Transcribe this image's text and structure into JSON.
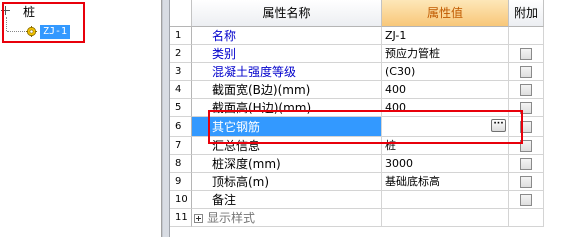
{
  "tree": {
    "root_label": "桩",
    "child_label": "ZJ-1"
  },
  "grid": {
    "headers": {
      "number": "",
      "name": "属性名称",
      "value": "属性值",
      "extra": "附加"
    },
    "rows": [
      {
        "num": "1",
        "name": "名称",
        "value": "ZJ-1",
        "name_color": "blue",
        "checkbox": false
      },
      {
        "num": "2",
        "name": "类别",
        "value": "预应力管桩",
        "name_color": "blue",
        "checkbox": true
      },
      {
        "num": "3",
        "name": "混凝土强度等级",
        "value": "(C30)",
        "name_color": "blue",
        "checkbox": true
      },
      {
        "num": "4",
        "name": "截面宽(B边)(mm)",
        "value": "400",
        "name_color": "black",
        "checkbox": true
      },
      {
        "num": "5",
        "name": "截面高(H边)(mm)",
        "value": "400",
        "name_color": "black",
        "checkbox": true
      },
      {
        "num": "6",
        "name": "其它钢筋",
        "value": "",
        "name_color": "black",
        "checkbox": true,
        "selected": true
      },
      {
        "num": "7",
        "name": "汇总信息",
        "value": "桩",
        "name_color": "black",
        "checkbox": true
      },
      {
        "num": "8",
        "name": "桩深度(mm)",
        "value": "3000",
        "name_color": "black",
        "checkbox": true
      },
      {
        "num": "9",
        "name": "顶标高(m)",
        "value": "基础底标高",
        "name_color": "black",
        "checkbox": true
      },
      {
        "num": "10",
        "name": "备注",
        "value": "",
        "name_color": "black",
        "checkbox": true
      },
      {
        "num": "11",
        "name": "显示样式",
        "value": "",
        "name_color": "gray",
        "checkbox": false,
        "expandable": true
      }
    ],
    "ellipsis_label": "···"
  },
  "colors": {
    "selection": "#3399ff",
    "annotation_box": "#e8000b",
    "value_header": "#f8c779",
    "blue_label": "#0000cc"
  }
}
